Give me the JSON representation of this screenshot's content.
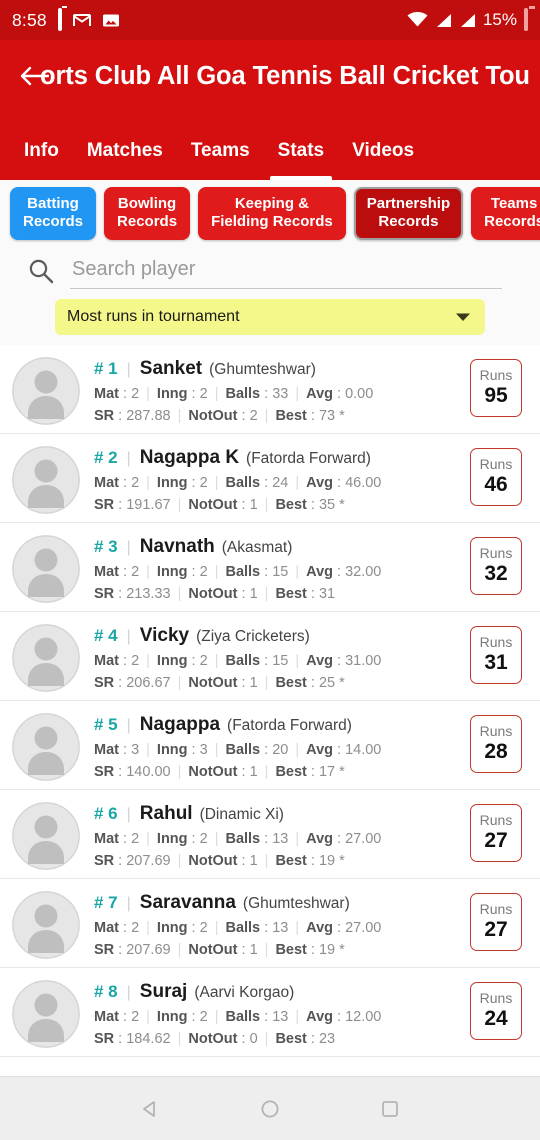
{
  "status_bar": {
    "time": "8:58",
    "battery_percent": "15%",
    "icons": [
      "battery-alert-icon",
      "gmail-icon",
      "photo-icon",
      "wifi-icon",
      "signal-icon",
      "signal-icon",
      "battery-icon"
    ]
  },
  "app_bar": {
    "back_icon": "back-arrow-icon",
    "title": "orts Club All Goa Tennis Ball Cricket Tou",
    "tabs": [
      {
        "label": "Info",
        "active": false
      },
      {
        "label": "Matches",
        "active": false
      },
      {
        "label": "Teams",
        "active": false
      },
      {
        "label": "Stats",
        "active": true
      },
      {
        "label": "Videos",
        "active": false
      }
    ]
  },
  "record_chips": [
    {
      "line1": "Batting",
      "line2": "Records",
      "state": "selected"
    },
    {
      "line1": "Bowling",
      "line2": "Records",
      "state": "normal"
    },
    {
      "line1": "Keeping &",
      "line2": "Fielding Records",
      "state": "normal"
    },
    {
      "line1": "Partnership",
      "line2": "Records",
      "state": "pressed"
    },
    {
      "line1": "Teams",
      "line2": "Records",
      "state": "normal"
    }
  ],
  "search": {
    "icon": "search-icon",
    "placeholder": "Search player",
    "value": ""
  },
  "filter_dropdown": {
    "selected": "Most runs in tournament",
    "caret_icon": "chevron-down-icon"
  },
  "colors": {
    "brand_red": "#d50f0f",
    "status_bar_red": "#c00d0d",
    "chip_selected_blue": "#2196f3",
    "chip_red": "#e01b1b",
    "chip_pressed_red": "#bb0d0d",
    "rank_teal": "#1aa6a6",
    "dropdown_yellow": "#f4f78a",
    "runs_border_red": "#c0392b"
  },
  "players": [
    {
      "rank": "# 1",
      "name": "Sanket",
      "team": "(Ghumteshwar)",
      "mat": "2",
      "inng": "2",
      "balls": "33",
      "avg": "0.00",
      "sr": "287.88",
      "notout": "2",
      "best": "73 *",
      "runs_label": "Runs",
      "runs": "95"
    },
    {
      "rank": "# 2",
      "name": "Nagappa K",
      "team": "(Fatorda Forward)",
      "mat": "2",
      "inng": "2",
      "balls": "24",
      "avg": "46.00",
      "sr": "191.67",
      "notout": "1",
      "best": "35 *",
      "runs_label": "Runs",
      "runs": "46"
    },
    {
      "rank": "# 3",
      "name": "Navnath",
      "team": "(Akasmat)",
      "mat": "2",
      "inng": "2",
      "balls": "15",
      "avg": "32.00",
      "sr": "213.33",
      "notout": "1",
      "best": "31",
      "runs_label": "Runs",
      "runs": "32"
    },
    {
      "rank": "# 4",
      "name": "Vicky",
      "team": "(Ziya Cricketers)",
      "mat": "2",
      "inng": "2",
      "balls": "15",
      "avg": "31.00",
      "sr": "206.67",
      "notout": "1",
      "best": "25 *",
      "runs_label": "Runs",
      "runs": "31"
    },
    {
      "rank": "# 5",
      "name": "Nagappa",
      "team": "(Fatorda Forward)",
      "mat": "3",
      "inng": "3",
      "balls": "20",
      "avg": "14.00",
      "sr": "140.00",
      "notout": "1",
      "best": "17 *",
      "runs_label": "Runs",
      "runs": "28"
    },
    {
      "rank": "# 6",
      "name": "Rahul",
      "team": "(Dinamic Xi)",
      "mat": "2",
      "inng": "2",
      "balls": "13",
      "avg": "27.00",
      "sr": "207.69",
      "notout": "1",
      "best": "19 *",
      "runs_label": "Runs",
      "runs": "27"
    },
    {
      "rank": "# 7",
      "name": "Saravanna",
      "team": "(Ghumteshwar)",
      "mat": "2",
      "inng": "2",
      "balls": "13",
      "avg": "27.00",
      "sr": "207.69",
      "notout": "1",
      "best": "19 *",
      "runs_label": "Runs",
      "runs": "27"
    },
    {
      "rank": "# 8",
      "name": "Suraj",
      "team": "(Aarvi Korgao)",
      "mat": "2",
      "inng": "2",
      "balls": "13",
      "avg": "12.00",
      "sr": "184.62",
      "notout": "0",
      "best": "23",
      "runs_label": "Runs",
      "runs": "24"
    }
  ],
  "stat_labels": {
    "mat": "Mat",
    "inng": "Inng",
    "balls": "Balls",
    "avg": "Avg",
    "sr": "SR",
    "notout": "NotOut",
    "best": "Best",
    "sep": ":"
  },
  "bottom_nav": {
    "back": "back-triangle-icon",
    "home": "home-circle-icon",
    "recents": "recents-square-icon"
  }
}
